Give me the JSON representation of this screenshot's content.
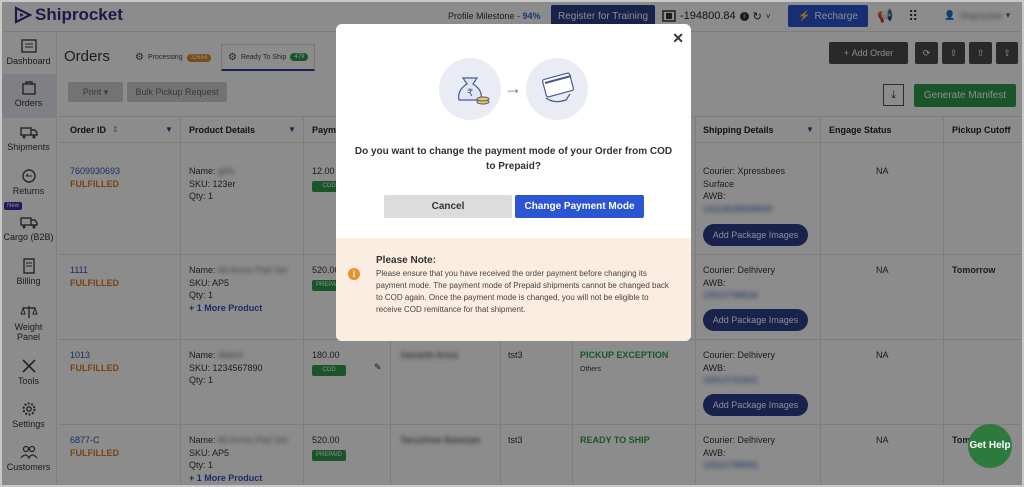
{
  "app": {
    "name": "Shiprocket"
  },
  "header": {
    "milestone_label": "Profile Milestone - ",
    "milestone_value": "94%",
    "register_label": "Register for Training",
    "wallet_balance": "-194800.84",
    "recharge_label": "Recharge",
    "user_name": "Shiprocket"
  },
  "sidebar": {
    "items": [
      {
        "label": "Dashboard",
        "icon": "dashboard-icon"
      },
      {
        "label": "Orders",
        "icon": "orders-icon"
      },
      {
        "label": "Shipments",
        "icon": "truck-icon"
      },
      {
        "label": "Returns",
        "icon": "returns-icon"
      },
      {
        "label": "Cargo (B2B)",
        "icon": "cargo-icon",
        "badge": "New"
      },
      {
        "label": "Billing",
        "icon": "billing-icon"
      },
      {
        "label": "Weight",
        "label2": "Panel",
        "icon": "scale-icon"
      },
      {
        "label": "Tools",
        "icon": "tools-icon"
      },
      {
        "label": "Settings",
        "icon": "gear-icon"
      },
      {
        "label": "Customers",
        "icon": "customers-icon"
      }
    ]
  },
  "page": {
    "title": "Orders",
    "tabs": [
      {
        "label": "Processing",
        "count": "32654"
      },
      {
        "label": "Ready To Ship",
        "count": "479"
      }
    ],
    "add_order": "Add Order",
    "print_label": "Print",
    "bulk_pickup_label": "Bulk Pickup Request",
    "generate_manifest": "Generate Manifest"
  },
  "table": {
    "headers": [
      "Order ID",
      "Product Details",
      "Paym",
      "Shipping Details",
      "Engage Status",
      "Pickup Cutoff"
    ],
    "rows": [
      {
        "order_id": "7609930693",
        "status": "FULFILLED",
        "name": "Name: ",
        "name_val": "gifts",
        "sku": "SKU: 123er",
        "qty": "Qty: 1",
        "more": "",
        "amount": "12.00",
        "pay_tag": "COD",
        "customer": "",
        "channel": "",
        "ship_status": "",
        "ship_sub": "",
        "courier": "Courier: Xpressbees",
        "courier2": "Surface",
        "awb": "AWB:",
        "awb_val": "14113535839609",
        "package": "Add Package Images",
        "engage": "NA",
        "cutoff": ""
      },
      {
        "order_id": "1111",
        "status": "FULFILLED",
        "name": "Name: ",
        "name_val": "All Arrive Pad Set",
        "sku": "SKU: AP5",
        "qty": "Qty: 1",
        "more": "+ 1 More Product",
        "amount": "520.00",
        "pay_tag": "PREPAID",
        "customer": "",
        "channel": "",
        "ship_status": "",
        "ship_sub": "",
        "courier": "Courier: Delhivery",
        "courier2": "",
        "awb": "AWB:",
        "awb_val": "15912798634",
        "package": "Add Package Images",
        "engage": "NA",
        "cutoff": "Tomorrow"
      },
      {
        "order_id": "1013",
        "status": "FULFILLED",
        "name": "Name: ",
        "name_val": "Watch",
        "sku": "SKU: 1234567890",
        "qty": "Qty: 1",
        "more": "",
        "amount": "180.00",
        "pay_tag": "COD",
        "customer": "Samarth Arora",
        "channel": "tst3",
        "ship_status": "PICKUP EXCEPTION",
        "ship_sub": "Others",
        "courier": "Courier: Delhivery",
        "courier2": "",
        "awb": "AWB:",
        "awb_val": "15912741601",
        "package": "Add Package Images",
        "engage": "NA",
        "cutoff": ""
      },
      {
        "order_id": "6877-C",
        "status": "FULFILLED",
        "name": "Name: ",
        "name_val": "All Arrive Pad Set",
        "sku": "SKU: AP5",
        "qty": "Qty: 1",
        "more": "+ 1 More Product",
        "amount": "520.00",
        "pay_tag": "PREPAID",
        "customer": "Tanushree Banerjee",
        "channel": "tst3",
        "ship_status": "READY TO SHIP",
        "ship_sub": "",
        "courier": "Courier: Delhivery",
        "courier2": "",
        "awb": "AWB:",
        "awb_val": "15912798692",
        "package": "Add Package Images",
        "engage": "NA",
        "cutoff": "Tom"
      }
    ]
  },
  "modal": {
    "question": "Do you want to change the payment mode of your Order from COD to Prepaid?",
    "cancel": "Cancel",
    "confirm": "Change Payment Mode",
    "note_title": "Please Note:",
    "note_text": "Please ensure that you have received the order payment before changing its payment mode. The payment mode of Prepaid shipments cannot be changed back to COD again. Once the payment mode is changed, you will not be eligible to receive COD remittance for that shipment."
  },
  "help": {
    "label": "Get Help"
  },
  "colors": {
    "brand": "#2c3e8c",
    "primary": "#2c55d4",
    "success": "#2e9b4b",
    "warning": "#d97a1a"
  }
}
